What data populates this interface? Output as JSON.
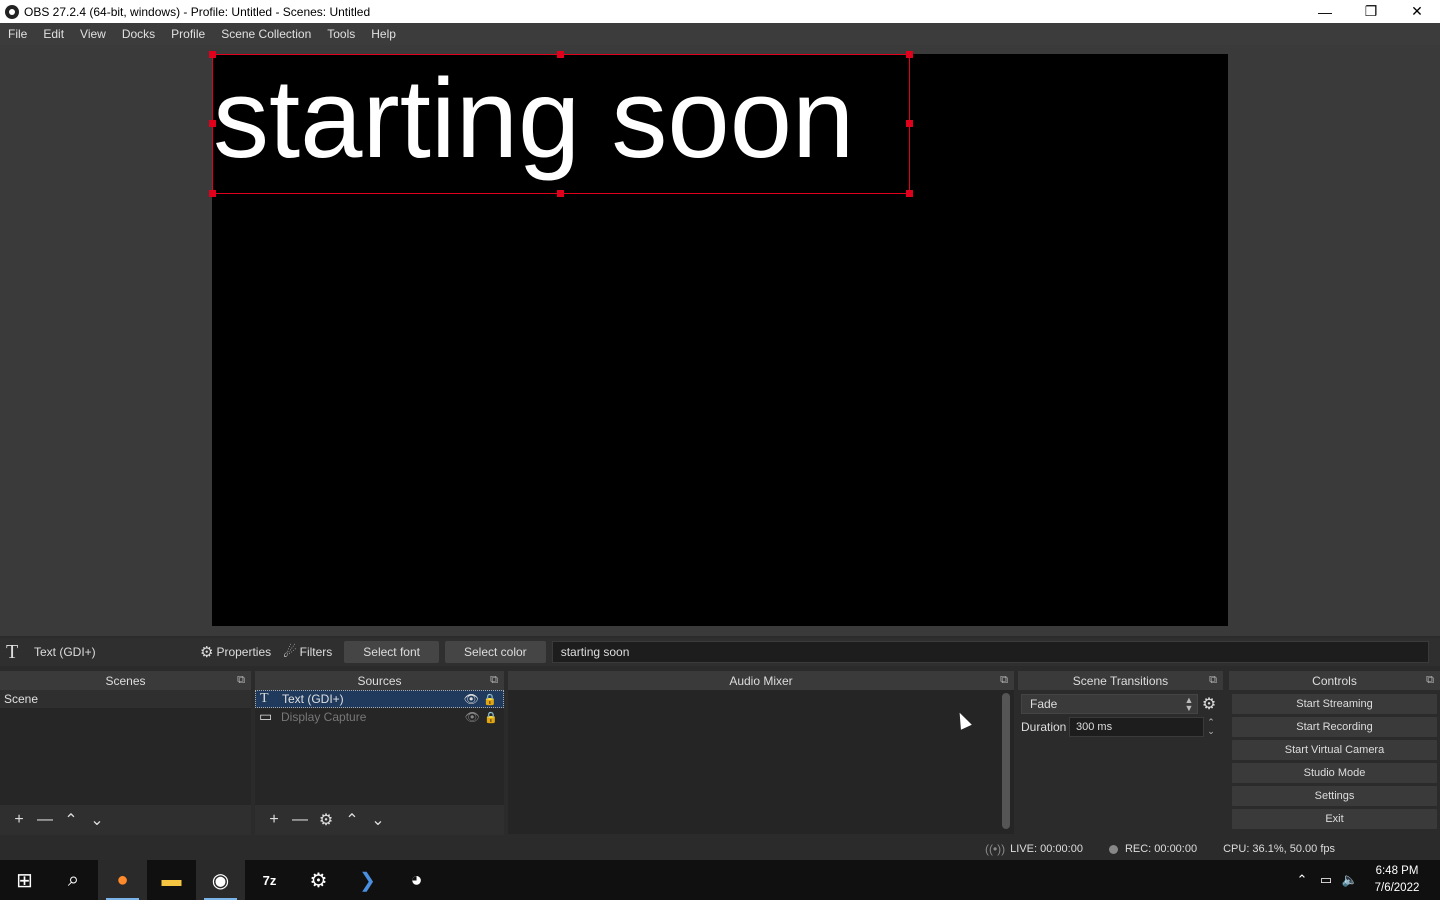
{
  "window": {
    "title": "OBS 27.2.4 (64-bit, windows) - Profile: Untitled - Scenes: Untitled",
    "minimize": "—",
    "restore": "❐",
    "close": "✕"
  },
  "menu": [
    "File",
    "Edit",
    "View",
    "Docks",
    "Profile",
    "Scene Collection",
    "Tools",
    "Help"
  ],
  "preview": {
    "text": "starting soon",
    "canvas_color": "#000000",
    "selection_color": "#e0001b"
  },
  "source_toolbar": {
    "type_icon": "T",
    "source_label": "Text (GDI+)",
    "properties_label": "Properties",
    "filters_label": "Filters",
    "select_font_label": "Select font",
    "select_color_label": "Select color",
    "text_value": "starting soon"
  },
  "scenes": {
    "title": "Scenes",
    "items": [
      "Scene"
    ]
  },
  "sources": {
    "title": "Sources",
    "items": [
      {
        "label": "Text (GDI+)",
        "icon": "text-icon",
        "visible": true,
        "locked": false,
        "selected": true
      },
      {
        "label": "Display Capture",
        "icon": "monitor-icon",
        "visible": false,
        "locked": false,
        "selected": false
      }
    ]
  },
  "audio_mixer": {
    "title": "Audio Mixer"
  },
  "transitions": {
    "title": "Scene Transitions",
    "selected": "Fade",
    "duration_label": "Duration",
    "duration_value": "300 ms"
  },
  "controls": {
    "title": "Controls",
    "buttons": [
      "Start Streaming",
      "Start Recording",
      "Start Virtual Camera",
      "Studio Mode",
      "Settings",
      "Exit"
    ]
  },
  "status": {
    "live": "LIVE: 00:00:00",
    "rec": "REC: 00:00:00",
    "cpu": "CPU: 36.1%, 50.00 fps"
  },
  "taskbar": {
    "apps": [
      "windows-start-icon",
      "search-icon",
      "firefox-icon",
      "file-explorer-icon",
      "obs-icon",
      "7zip-icon",
      "settings-gear-icon",
      "powershell-icon",
      "steam-controller-icon"
    ],
    "time": "6:48 PM",
    "date": "7/6/2022"
  }
}
